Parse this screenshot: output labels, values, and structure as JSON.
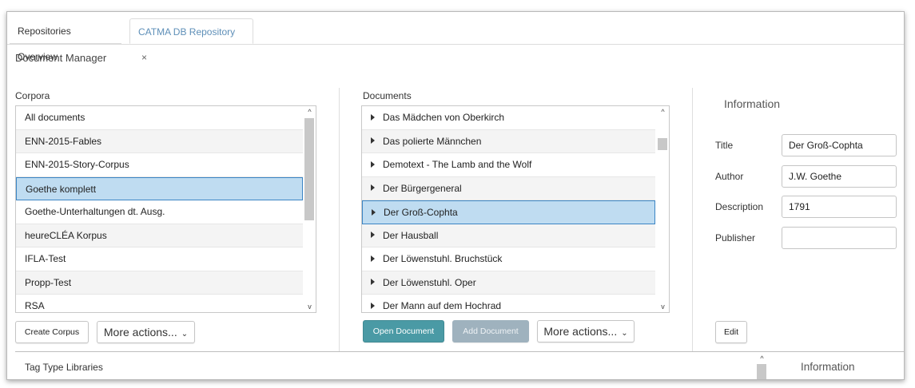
{
  "tabs": [
    {
      "label": "Repositories Overview"
    },
    {
      "label": "CATMA DB Repository",
      "close": "×"
    }
  ],
  "page_title": "Document Manager",
  "corpora": {
    "label": "Corpora",
    "items": [
      "All documents",
      "ENN-2015-Fables",
      "ENN-2015-Story-Corpus",
      "Goethe komplett",
      "Goethe-Unterhaltungen dt. Ausg.",
      "heureCLÉA Korpus",
      "IFLA-Test",
      "Propp-Test",
      "RSA"
    ],
    "selected": "Goethe komplett",
    "create_button": "Create Corpus",
    "more_button": "More actions...",
    "chevron": "⌄"
  },
  "documents": {
    "label": "Documents",
    "items": [
      "Das Mädchen von Oberkirch",
      "Das polierte Männchen",
      "Demotext - The Lamb and the Wolf",
      "Der Bürgergeneral",
      "Der Groß-Cophta",
      "Der Hausball",
      "Der Löwenstuhl. Bruchstück",
      "Der Löwenstuhl. Oper",
      "Der Mann auf dem Hochrad"
    ],
    "selected": "Der Groß-Cophta",
    "open_button": "Open Document",
    "add_button": "Add Document",
    "more_button": "More actions...",
    "chevron": "⌄"
  },
  "information": {
    "title": "Information",
    "fields": [
      {
        "label": "Title",
        "value": "Der Groß-Cophta"
      },
      {
        "label": "Author",
        "value": "J.W. Goethe"
      },
      {
        "label": "Description",
        "value": "1791"
      },
      {
        "label": "Publisher",
        "value": ""
      }
    ],
    "edit_button": "Edit"
  },
  "tag_type_libraries": {
    "label": "Tag Type Libraries",
    "info_title": "Information"
  },
  "scroll_symbols": {
    "up": "^",
    "down": "v"
  },
  "colors": {
    "accent": "#4a9aa5",
    "selection": "#bfdcf1",
    "selection_border": "#3b85c4",
    "tab_active_text": "#5e8fb8"
  }
}
